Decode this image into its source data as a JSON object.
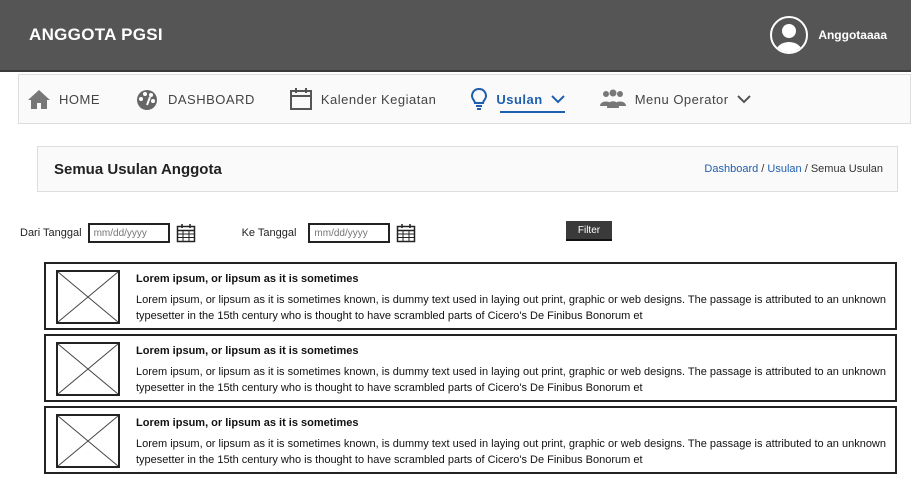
{
  "app": {
    "title": "ANGGOTA PGSI",
    "user_name": "Anggotaaaa"
  },
  "nav": {
    "items": [
      {
        "label": "HOME",
        "icon": "home-icon"
      },
      {
        "label": "DASHBOARD",
        "icon": "dashboard-icon"
      },
      {
        "label": "Kalender Kegiatan",
        "icon": "calendar-icon"
      },
      {
        "label": "Usulan",
        "icon": "lightbulb-icon",
        "active": true,
        "dropdown": true
      },
      {
        "label": "Menu Operator",
        "icon": "users-icon",
        "dropdown": true
      }
    ]
  },
  "page": {
    "title": "Semua Usulan Anggota",
    "breadcrumb": {
      "dashboard": "Dashboard",
      "sep1": " / ",
      "usulan": "Usulan",
      "sep2": " / ",
      "current": "Semua Usulan"
    }
  },
  "filter": {
    "from_label": "Dari Tanggal",
    "from_placeholder": "mm/dd/yyyy",
    "to_label": "Ke Tanggal",
    "to_placeholder": "mm/dd/yyyy",
    "button_label": "Filter"
  },
  "items": [
    {
      "title": "Lorem ipsum, or lipsum as it is sometimes",
      "text": "Lorem ipsum, or lipsum as it is sometimes known, is dummy text used in laying out print, graphic or web designs. The passage is attributed to an unknown typesetter in the 15th century who is thought to have scrambled parts of Cicero's De Finibus Bonorum et"
    },
    {
      "title": "Lorem ipsum, or lipsum as it is sometimes",
      "text": "Lorem ipsum, or lipsum as it is sometimes known, is dummy text used in laying out print, graphic or web designs. The passage is attributed to an unknown typesetter in the 15th century who is thought to have scrambled parts of Cicero's De Finibus Bonorum et"
    },
    {
      "title": "Lorem ipsum, or lipsum as it is sometimes",
      "text": "Lorem ipsum, or lipsum as it is sometimes known, is dummy text used in laying out print, graphic or web designs. The passage is attributed to an unknown typesetter in the 15th century who is thought to have scrambled parts of Cicero's De Finibus Bonorum et"
    }
  ],
  "colors": {
    "topbar": "#555555",
    "accent": "#1f5fae",
    "button": "#3a3a3a"
  }
}
